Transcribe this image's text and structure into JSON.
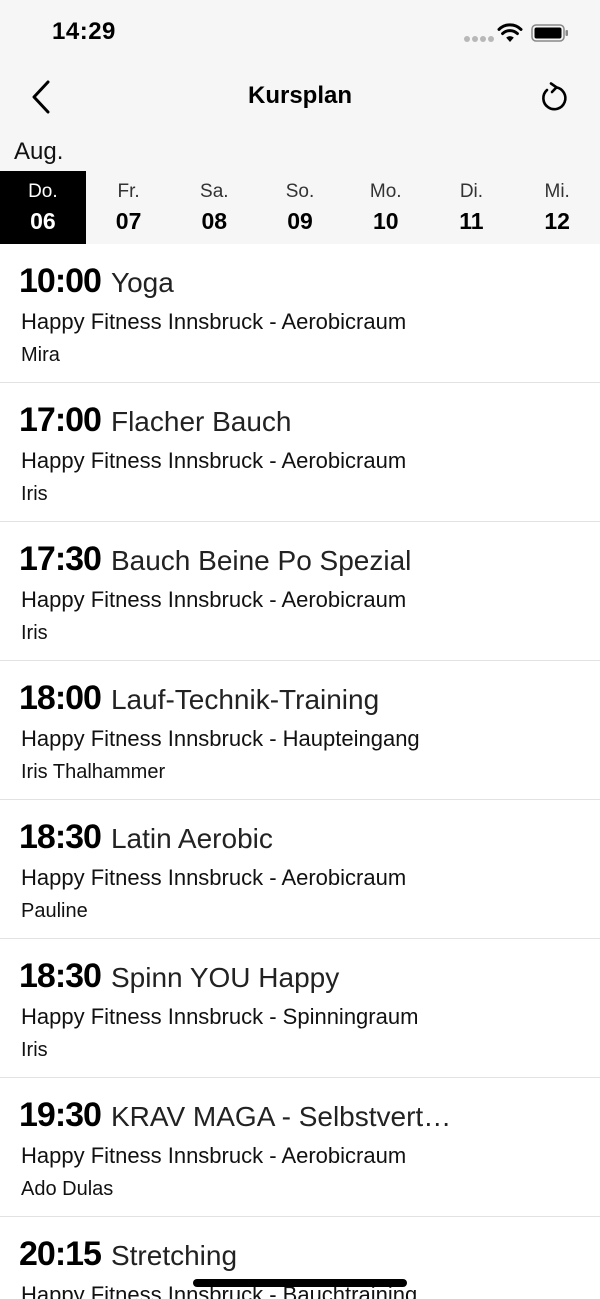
{
  "status_bar": {
    "time": "14:29"
  },
  "nav": {
    "title": "Kursplan",
    "back_icon": "chevron-left-icon",
    "refresh_icon": "refresh-icon"
  },
  "month": "Aug.",
  "days": [
    {
      "name": "Do.",
      "num": "06",
      "selected": true
    },
    {
      "name": "Fr.",
      "num": "07",
      "selected": false
    },
    {
      "name": "Sa.",
      "num": "08",
      "selected": false
    },
    {
      "name": "So.",
      "num": "09",
      "selected": false
    },
    {
      "name": "Mo.",
      "num": "10",
      "selected": false
    },
    {
      "name": "Di.",
      "num": "11",
      "selected": false
    },
    {
      "name": "Mi.",
      "num": "12",
      "selected": false
    }
  ],
  "courses": [
    {
      "time": "10:00",
      "name": "Yoga",
      "location": "Happy Fitness Innsbruck - Aerobicraum",
      "trainer": "Mira"
    },
    {
      "time": "17:00",
      "name": "Flacher Bauch",
      "location": "Happy Fitness Innsbruck - Aerobicraum",
      "trainer": "Iris"
    },
    {
      "time": "17:30",
      "name": "Bauch Beine Po Spezial",
      "location": "Happy Fitness Innsbruck - Aerobicraum",
      "trainer": "Iris"
    },
    {
      "time": "18:00",
      "name": "Lauf-Technik-Training",
      "location": "Happy Fitness Innsbruck - Haupteingang",
      "trainer": "Iris Thalhammer"
    },
    {
      "time": "18:30",
      "name": "Latin Aerobic",
      "location": "Happy Fitness Innsbruck - Aerobicraum",
      "trainer": "Pauline"
    },
    {
      "time": "18:30",
      "name": "Spinn YOU Happy",
      "location": "Happy Fitness Innsbruck - Spinningraum",
      "trainer": "Iris"
    },
    {
      "time": "19:30",
      "name": "KRAV MAGA - Selbstvert…",
      "location": "Happy Fitness Innsbruck - Aerobicraum",
      "trainer": "Ado Dulas"
    },
    {
      "time": "20:15",
      "name": "Stretching",
      "location": "Happy Fitness Innsbruck - Bauchtraining",
      "trainer": ""
    }
  ],
  "colors": {
    "header_bg": "#f6f6f6",
    "selected_bg": "#000000",
    "divider": "#e2e2e2"
  }
}
